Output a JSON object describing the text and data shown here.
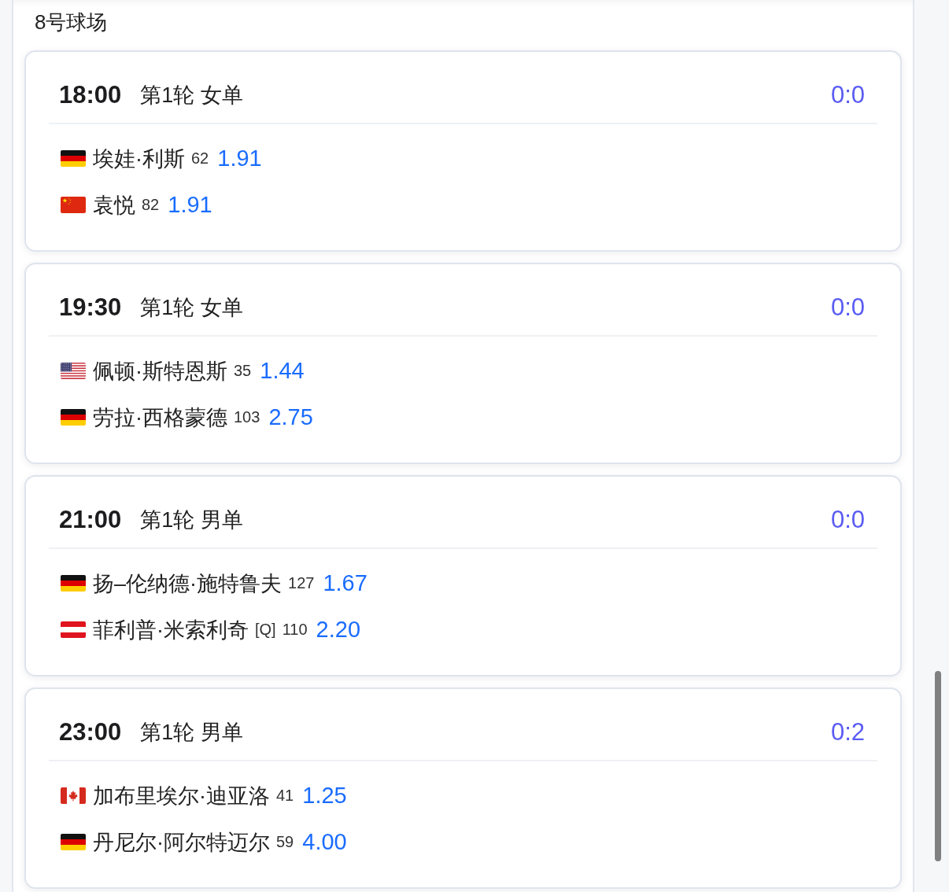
{
  "court": {
    "title": "8号球场"
  },
  "matches": [
    {
      "time": "18:00",
      "round": "第1轮 女单",
      "score": "0:0",
      "players": [
        {
          "kind": "germany",
          "name": "埃娃·利斯",
          "rank": "62",
          "odds": "1.91"
        },
        {
          "kind": "china",
          "name": "袁悦",
          "rank": "82",
          "odds": "1.91"
        }
      ]
    },
    {
      "time": "19:30",
      "round": "第1轮 女单",
      "score": "0:0",
      "players": [
        {
          "kind": "usa",
          "name": "佩顿·斯特恩斯",
          "rank": "35",
          "odds": "1.44"
        },
        {
          "kind": "germany",
          "name": "劳拉·西格蒙德",
          "rank": "103",
          "odds": "2.75"
        }
      ]
    },
    {
      "time": "21:00",
      "round": "第1轮 男单",
      "score": "0:0",
      "players": [
        {
          "kind": "germany",
          "name": "扬–伦纳德·施特鲁夫",
          "rank": "127",
          "odds": "1.67"
        },
        {
          "kind": "austria",
          "name": "菲利普·米索利奇",
          "tag": "[Q]",
          "rank": "110",
          "odds": "2.20"
        }
      ]
    },
    {
      "time": "23:00",
      "round": "第1轮 男单",
      "score": "0:2",
      "players": [
        {
          "kind": "canada",
          "name": "加布里埃尔·迪亚洛",
          "rank": "41",
          "odds": "1.25"
        },
        {
          "kind": "germany",
          "name": "丹尼尔·阿尔特迈尔",
          "rank": "59",
          "odds": "4.00"
        }
      ]
    }
  ]
}
